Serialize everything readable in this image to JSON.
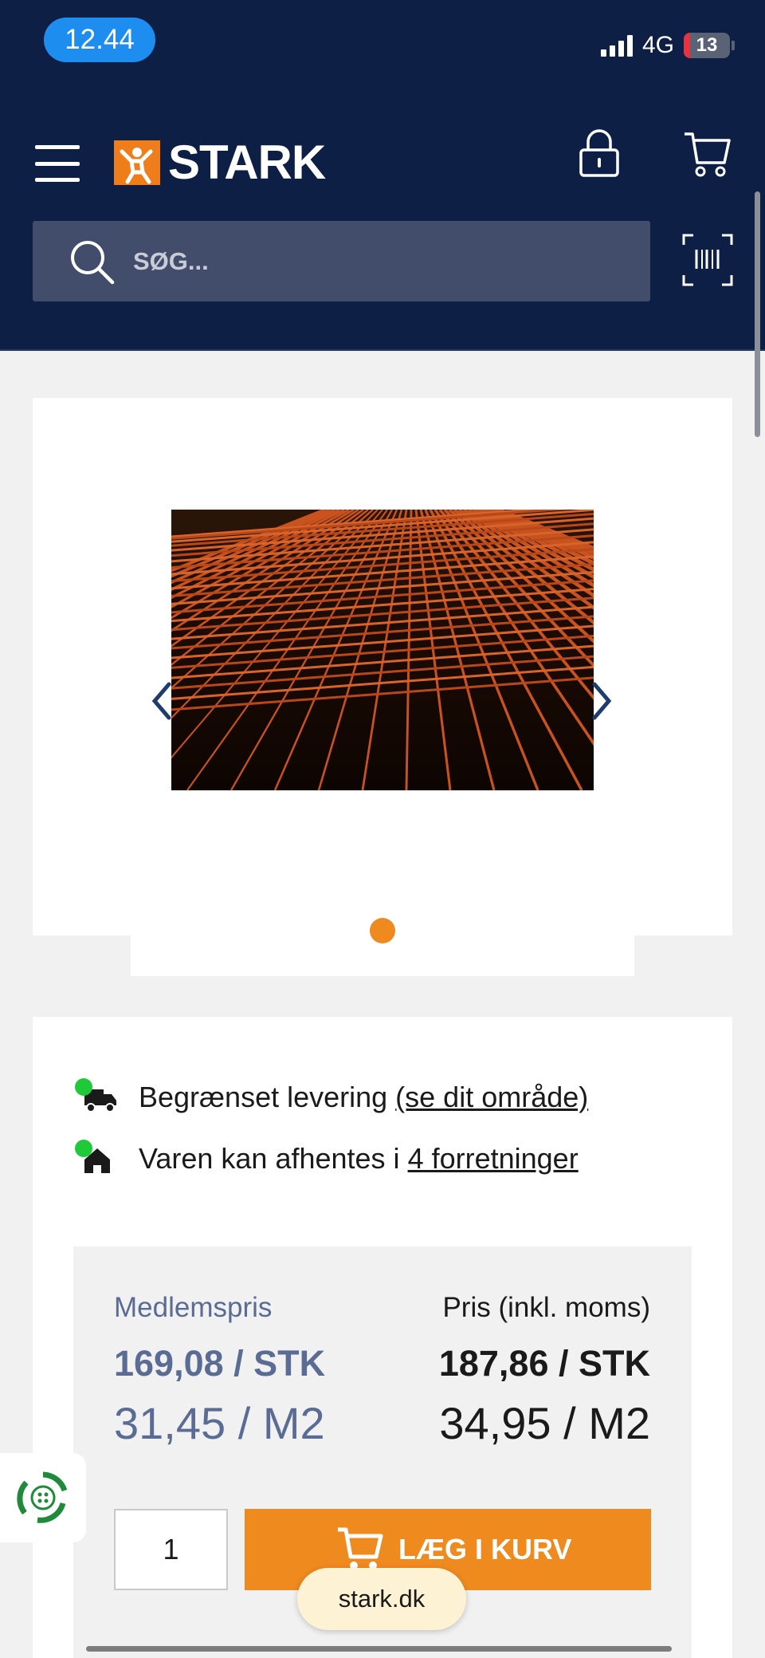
{
  "status_bar": {
    "time": "12.44",
    "network": "4G",
    "battery": "13",
    "battery_level": 0.13
  },
  "header": {
    "brand": "STARK",
    "search_placeholder": "SØG..."
  },
  "gallery": {
    "image_count": 1,
    "active_index": 0
  },
  "availability": {
    "delivery_text": "Begrænset levering",
    "delivery_link": "(se dit område)",
    "pickup_text": "Varen kan afhentes i",
    "pickup_link": "4 forretninger"
  },
  "pricing": {
    "member_label": "Medlemspris",
    "member_stk": "169,08 / STK",
    "member_m2": "31,45 / M2",
    "regular_label": "Pris (inkl. moms)",
    "regular_stk": "187,86 / STK",
    "regular_m2": "34,95 / M2"
  },
  "cart": {
    "quantity": "1",
    "add_label": "LÆG I KURV"
  },
  "browser": {
    "url": "stark.dk"
  },
  "colors": {
    "header_bg": "#0d1f45",
    "accent": "#ef8a1f",
    "member_price": "#5a6c93",
    "available": "#1fc93a"
  }
}
